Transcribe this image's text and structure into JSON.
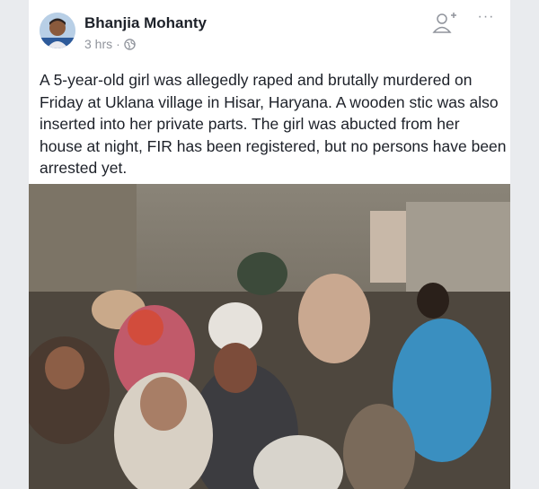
{
  "post": {
    "author": "Bhanjia Mohanty",
    "timestamp": "3 hrs",
    "separator": "·",
    "privacy_icon": "globe-icon",
    "text": "A 5-year-old girl was allegedly raped and brutally murdered on Friday at Uklana village in Hisar, Haryana. A wooden stic was also inserted into her private parts. The girl was abucted from her house at night, FIR has been registered, but no persons have been arrested yet."
  },
  "actions": {
    "add_friend_icon": "add-friend-icon",
    "more_label": "···"
  },
  "colors": {
    "name": "#1d2129",
    "meta": "#90949c",
    "background": "#e9ebee"
  }
}
